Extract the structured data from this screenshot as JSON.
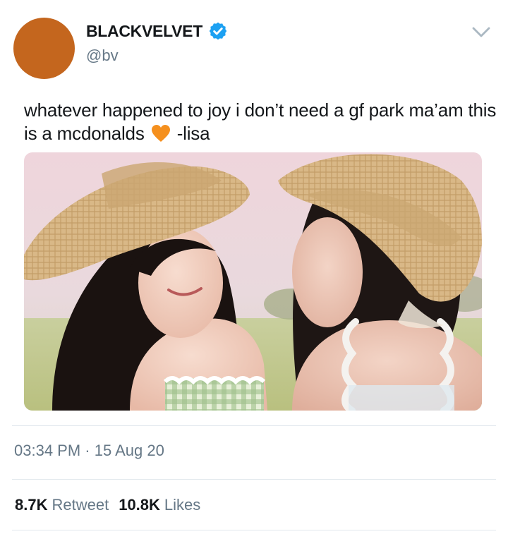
{
  "colors": {
    "avatar": "#c4661e",
    "verified": "#1da1f2",
    "heart": "#f5901e",
    "secondary_text": "#657786",
    "divider": "#e1e8ed"
  },
  "author": {
    "display_name": "BLACKVELVET",
    "handle": "@bv",
    "verified": true
  },
  "tweet": {
    "text_before_emoji": "whatever happened to joy i don’t need a gf park ma’am this is a mcdonalds",
    "emoji": "orange-heart-icon",
    "text_after_emoji": "-lisa"
  },
  "media": {
    "icon": "photo-two-women-straw-hats"
  },
  "meta": {
    "timestamp": "03:34 PM · 15 Aug 20"
  },
  "stats": {
    "retweets_count": "8.7K",
    "retweets_label": "Retweet",
    "likes_count": "10.8K",
    "likes_label": "Likes"
  }
}
